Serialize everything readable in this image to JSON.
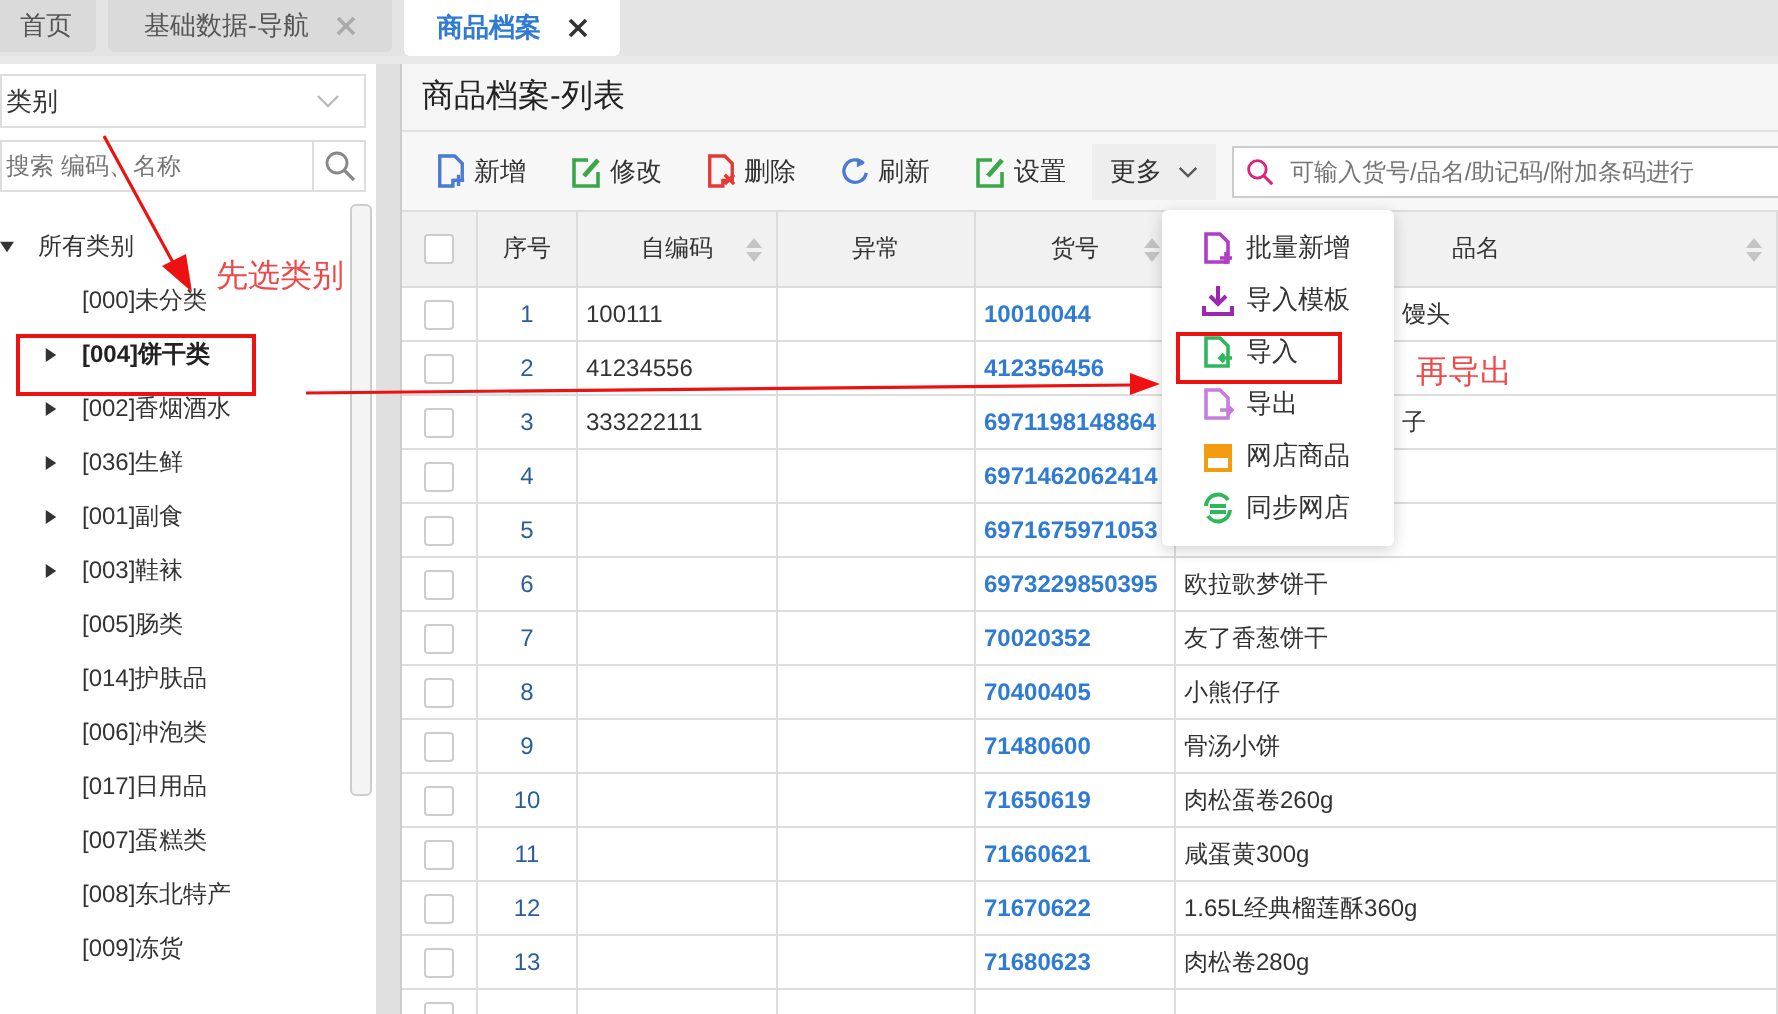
{
  "tabs": [
    {
      "label": "首页",
      "closable": false,
      "selected": false
    },
    {
      "label": "基础数据-导航",
      "closable": true,
      "selected": false
    },
    {
      "label": "商品档案",
      "closable": true,
      "selected": true
    }
  ],
  "sidebar": {
    "category_select": {
      "value": "类别"
    },
    "search": {
      "placeholder": "搜索 编码、名称"
    },
    "tree": {
      "label": "所有类别",
      "expanded": true,
      "children": [
        {
          "label": "[000]未分类",
          "kind": "leaf",
          "selected": false
        },
        {
          "label": "[004]饼干类",
          "kind": "branch",
          "expanded": false,
          "selected": true
        },
        {
          "label": "[002]香烟酒水",
          "kind": "branch",
          "expanded": false,
          "selected": false
        },
        {
          "label": "[036]生鲜",
          "kind": "branch",
          "expanded": false,
          "selected": false
        },
        {
          "label": "[001]副食",
          "kind": "branch",
          "expanded": false,
          "selected": false
        },
        {
          "label": "[003]鞋袜",
          "kind": "branch",
          "expanded": false,
          "selected": false
        },
        {
          "label": "[005]肠类",
          "kind": "leaf",
          "selected": false
        },
        {
          "label": "[014]护肤品",
          "kind": "leaf",
          "selected": false
        },
        {
          "label": "[006]冲泡类",
          "kind": "leaf",
          "selected": false
        },
        {
          "label": "[017]日用品",
          "kind": "leaf",
          "selected": false
        },
        {
          "label": "[007]蛋糕类",
          "kind": "leaf",
          "selected": false
        },
        {
          "label": "[008]东北特产",
          "kind": "leaf",
          "selected": false
        },
        {
          "label": "[009]冻货",
          "kind": "leaf",
          "selected": false
        }
      ]
    }
  },
  "main": {
    "title": "商品档案-列表",
    "toolbar": [
      {
        "label": "新增",
        "kind": "add"
      },
      {
        "label": "修改",
        "kind": "edit"
      },
      {
        "label": "删除",
        "kind": "delete"
      },
      {
        "label": "刷新",
        "kind": "refresh"
      },
      {
        "label": "设置",
        "kind": "settings"
      },
      {
        "label": "更多",
        "kind": "more"
      }
    ],
    "search": {
      "placeholder": "可输入货号/品名/助记码/附加条码进行"
    },
    "more_menu": [
      {
        "label": "批量新增",
        "kind": "batch"
      },
      {
        "label": "导入模板",
        "kind": "download"
      },
      {
        "label": "导入",
        "kind": "import"
      },
      {
        "label": "导出",
        "kind": "export"
      },
      {
        "label": "网店商品",
        "kind": "shop"
      },
      {
        "label": "同步网店",
        "kind": "sync"
      }
    ],
    "table": {
      "select_all_checked": false,
      "columns": [
        {
          "label": "序号",
          "sortable": false
        },
        {
          "label": "自编码",
          "sortable": true
        },
        {
          "label": "异常",
          "sortable": false
        },
        {
          "label": "货号",
          "sortable": true
        },
        {
          "label": "品名",
          "sortable": true
        }
      ],
      "rows": [
        {
          "checked": false,
          "no": "1",
          "code": "100111",
          "sku": "10010044",
          "name": "馒头"
        },
        {
          "checked": false,
          "no": "2",
          "code": "41234556",
          "sku": "412356456"
        },
        {
          "checked": false,
          "no": "3",
          "code": "333222111",
          "sku": "6971198148864",
          "name": "子"
        },
        {
          "checked": false,
          "no": "4",
          "sku": "6971462062414"
        },
        {
          "checked": false,
          "no": "5",
          "sku": "6971675971053"
        },
        {
          "checked": false,
          "no": "6",
          "sku": "6973229850395",
          "name": "欧拉歌梦饼干"
        },
        {
          "checked": false,
          "no": "7",
          "sku": "70020352",
          "name": "友了香葱饼干"
        },
        {
          "checked": false,
          "no": "8",
          "sku": "70400405",
          "name": "小熊仔仔"
        },
        {
          "checked": false,
          "no": "9",
          "sku": "71480600",
          "name": "骨汤小饼"
        },
        {
          "checked": false,
          "no": "10",
          "sku": "71650619",
          "name": "肉松蛋卷260g"
        },
        {
          "checked": false,
          "no": "11",
          "sku": "71660621",
          "name": "咸蛋黄300g"
        },
        {
          "checked": false,
          "no": "12",
          "sku": "71670622",
          "name": "1.65L经典榴莲酥360g"
        },
        {
          "checked": false,
          "no": "13",
          "sku": "71680623",
          "name": "肉松卷280g"
        },
        {
          "checked": false
        }
      ]
    }
  },
  "annotations": [
    {
      "text": "先选类别",
      "kind": "step1"
    },
    {
      "text": "再导出",
      "kind": "step2"
    }
  ]
}
